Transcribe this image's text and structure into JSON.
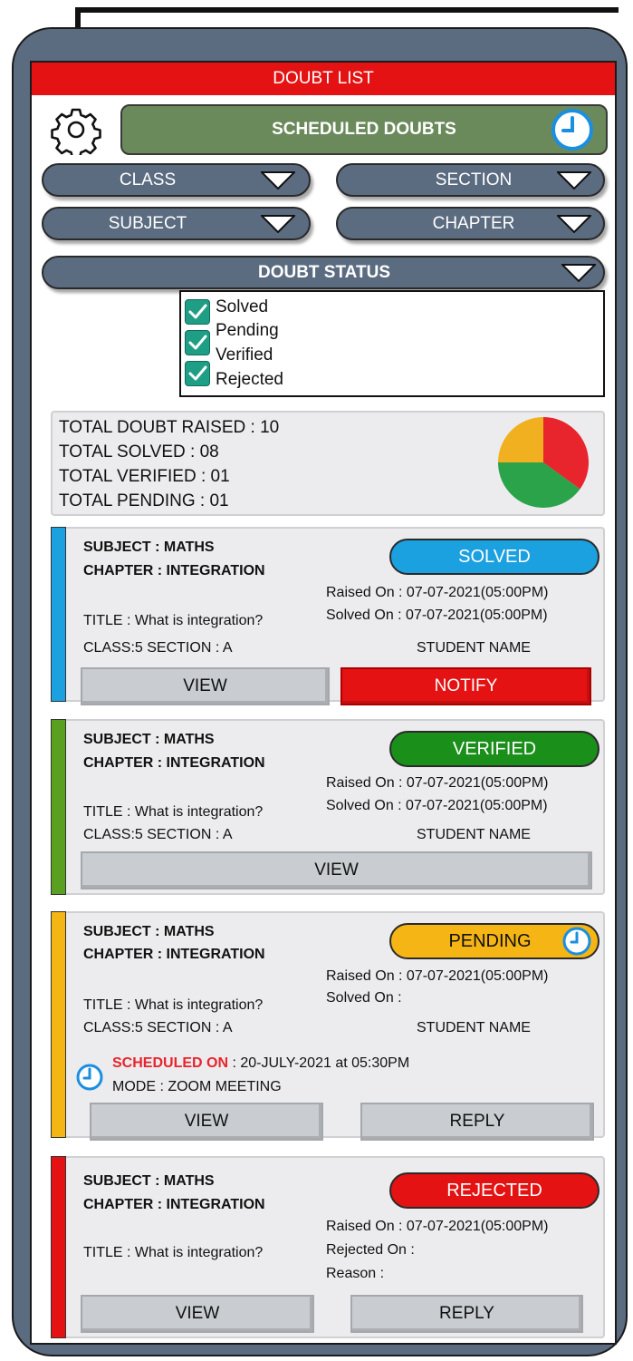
{
  "header": {
    "title": "DOUBT LIST"
  },
  "scheduled_button": {
    "label": "SCHEDULED DOUBTS"
  },
  "filters": {
    "class": "CLASS",
    "section": "SECTION",
    "subject": "SUBJECT",
    "chapter": "CHAPTER",
    "doubt_status": "DOUBT STATUS"
  },
  "status_options": [
    {
      "label": "Solved",
      "checked": true
    },
    {
      "label": "Pending",
      "checked": true
    },
    {
      "label": "Verified",
      "checked": true
    },
    {
      "label": "Rejected",
      "checked": true
    }
  ],
  "summary": {
    "total_raised": "TOTAL  DOUBT RAISED : 10",
    "total_solved": "TOTAL SOLVED : 08",
    "total_verified": "TOTAL VERIFIED : 01",
    "total_pending": "TOTAL PENDING : 01",
    "pie_slices": [
      {
        "name": "Solved",
        "value": 0.4,
        "color": "#2aa34a"
      },
      {
        "name": "Red",
        "value": 0.35,
        "color": "#e8242c"
      },
      {
        "name": "Yellow",
        "value": 0.25,
        "color": "#f0b020"
      }
    ]
  },
  "cards": [
    {
      "status": "SOLVED",
      "accent": "#1ba0e0",
      "subject": "SUBJECT :  MATHS",
      "chapter": "CHAPTER : INTEGRATION",
      "raised": "Raised  On :  07-07-2021(05:00PM)",
      "second": "Solved  On :  07-07-2021(05:00PM)",
      "title": "TITLE : What is integration?",
      "class_section": "CLASS:5   SECTION : A",
      "student": "STUDENT NAME",
      "view": "VIEW",
      "notify": "NOTIFY"
    },
    {
      "status": "VERIFIED",
      "accent": "#5aa020",
      "subject": "SUBJECT :  MATHS",
      "chapter": "CHAPTER : INTEGRATION",
      "raised": "Raised  On :  07-07-2021(05:00PM)",
      "second": "Solved  On :  07-07-2021(05:00PM)",
      "title": "TITLE : What is integration?",
      "class_section": "CLASS:5    SECTION : A",
      "student": "STUDENT NAME",
      "view": "VIEW"
    },
    {
      "status": "PENDING",
      "accent": "#f5b514",
      "subject": "SUBJECT :  MATHS",
      "chapter": "CHAPTER : INTEGRATION",
      "raised": "Raised  On :  07-07-2021(05:00PM)",
      "second": "Solved  On :",
      "title": "TITLE : What is integration?",
      "class_section": "CLASS:5    SECTION : A",
      "student": "STUDENT NAME",
      "scheduled_label": "SCHEDULED ON",
      "scheduled_value": " : 20-JULY-2021 at 05:30PM",
      "mode": "MODE : ZOOM MEETING",
      "view": "VIEW",
      "reply": "REPLY"
    },
    {
      "status": "REJECTED",
      "accent": "#e41212",
      "subject": "SUBJECT :  MATHS",
      "chapter": "CHAPTER : INTEGRATION",
      "raised": "Raised  On :  07-07-2021(05:00PM)",
      "second": "Rejected  On :",
      "reason": "Reason :",
      "title": "TITLE : What is integration?",
      "view": "VIEW",
      "reply": "REPLY"
    }
  ]
}
